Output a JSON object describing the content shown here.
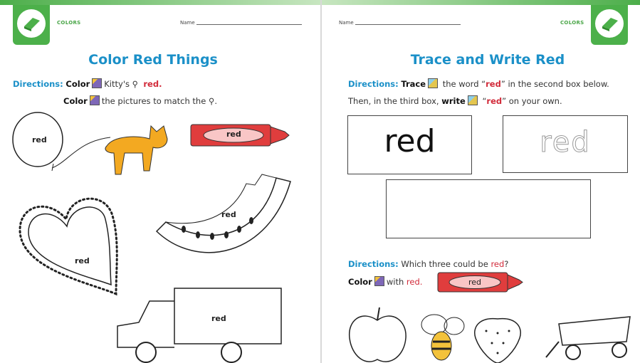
{
  "left_page": {
    "section": "COLORS",
    "name_label": "Name",
    "title": "Color Red Things",
    "directions_label": "Directions:",
    "line1": {
      "verb": "Color",
      "text": "Kitty's",
      "color_word": "red."
    },
    "line2": {
      "verb": "Color",
      "text": "the pictures to match the",
      "end": "."
    },
    "picture_labels": {
      "balloon": "red",
      "crayon": "red",
      "watermelon": "red",
      "heart": "red",
      "truck": "red"
    }
  },
  "right_page": {
    "section": "COLORS",
    "name_label": "Name",
    "title": "Trace and Write Red",
    "directions_label": "Directions:",
    "line1": {
      "verb": "Trace",
      "text_a": "the word “",
      "color_word": "red",
      "text_b": "” in the second box below."
    },
    "line2": {
      "text_a": "Then, in the third box,",
      "verb": "write",
      "text_b": "“",
      "color_word": "red",
      "text_c": "” on your own."
    },
    "box1_word": "red",
    "box2_trace_word": "red",
    "directions2_label": "Directions:",
    "question": "Which three could be",
    "question_color": "red",
    "question_end": "?",
    "line3": {
      "verb": "Color",
      "text": "with",
      "color_word": "red."
    },
    "crayon_label": "red"
  },
  "colors": {
    "green": "#4cb04a",
    "title_blue": "#1b90c8",
    "red": "#d22b3a"
  },
  "icons": [
    "book-icon",
    "crayon-icon",
    "pencil-icon",
    "balloon-icon"
  ]
}
